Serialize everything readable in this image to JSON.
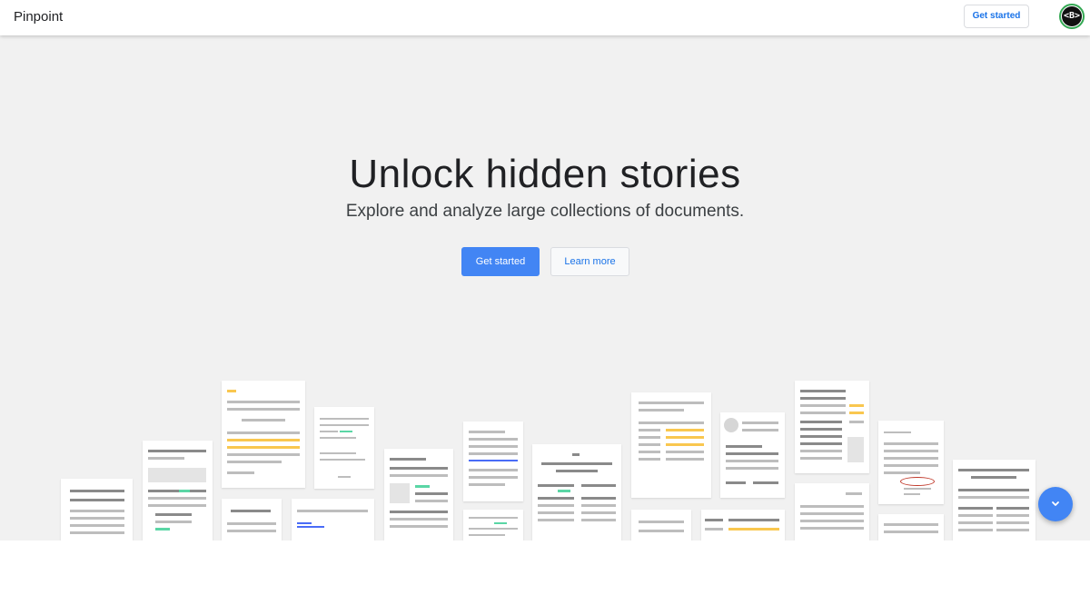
{
  "header": {
    "logo": "Pinpoint",
    "get_started": "Get started",
    "avatar_text": "<B>"
  },
  "hero": {
    "title": "Unlock hidden stories",
    "subtitle": "Explore and analyze large collections of documents.",
    "primary_button": "Get started",
    "secondary_button": "Learn more"
  },
  "icons": {
    "scroll_down": "chevron-down-icon",
    "avatar": "avatar-icon"
  },
  "colors": {
    "accent": "#4285f4",
    "link": "#1a73e8",
    "hero_bg": "#f1f1f1",
    "highlight_yellow": "#f9c74f",
    "highlight_green": "#5ad6a5"
  }
}
